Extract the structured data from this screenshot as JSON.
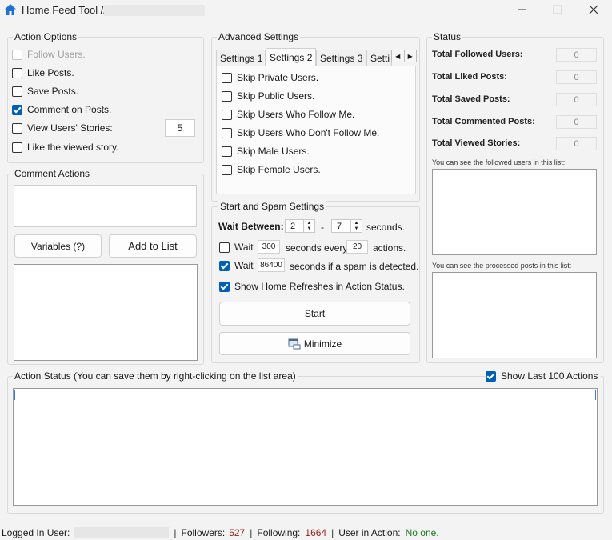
{
  "window": {
    "title": "Home Feed Tool //",
    "minimize_icon": "minimize-icon",
    "maximize_icon": "maximize-icon",
    "close_icon": "close-icon"
  },
  "action_options": {
    "title": "Action Options",
    "items": [
      {
        "label": "Follow Users.",
        "checked": false,
        "disabled": true
      },
      {
        "label": "Like Posts.",
        "checked": false,
        "disabled": false
      },
      {
        "label": "Save Posts.",
        "checked": false,
        "disabled": false
      },
      {
        "label": "Comment on Posts.",
        "checked": true,
        "disabled": false
      },
      {
        "label": "View Users' Stories:",
        "checked": false,
        "disabled": false
      },
      {
        "label": "Like the viewed story.",
        "checked": false,
        "disabled": false
      }
    ],
    "stories_count": "5"
  },
  "comment_actions": {
    "title": "Comment Actions",
    "comment_value": "",
    "variables_label": "Variables (?)",
    "add_label": "Add to List"
  },
  "advanced": {
    "title": "Advanced Settings",
    "tabs": [
      "Settings 1",
      "Settings 2",
      "Settings 3",
      "Setti"
    ],
    "active_tab": "Settings 2",
    "items": [
      {
        "label": "Skip Private Users.",
        "checked": false
      },
      {
        "label": "Skip Public Users.",
        "checked": false
      },
      {
        "label": "Skip Users Who Follow Me.",
        "checked": false
      },
      {
        "label": "Skip Users Who Don't Follow Me.",
        "checked": false
      },
      {
        "label": "Skip Male Users.",
        "checked": false
      },
      {
        "label": "Skip Female Users.",
        "checked": false
      }
    ]
  },
  "start_spam": {
    "title": "Start and Spam Settings",
    "wait_between_label": "Wait Between:",
    "wait_min": "2",
    "dash": "-",
    "wait_max": "7",
    "seconds_label": "seconds.",
    "wait_every": {
      "checked": false,
      "label": "Wait",
      "seconds": "300",
      "mid": "seconds every",
      "actions": "20",
      "end": "actions."
    },
    "wait_spam": {
      "checked": true,
      "label": "Wait",
      "seconds": "86400",
      "end": "seconds if a spam is detected."
    },
    "show_refresh": {
      "checked": true,
      "label": "Show Home Refreshes in Action Status."
    },
    "start_label": "Start",
    "minimize_label": "Minimize"
  },
  "status": {
    "title": "Status",
    "rows": [
      {
        "label": "Total Followed Users:",
        "value": "0"
      },
      {
        "label": "Total Liked Posts:",
        "value": "0"
      },
      {
        "label": "Total Saved Posts:",
        "value": "0"
      },
      {
        "label": "Total Commented Posts:",
        "value": "0"
      },
      {
        "label": "Total Viewed Stories:",
        "value": "0"
      }
    ],
    "followed_hint": "You can see the followed users in this list:",
    "processed_hint": "You can see the processed posts in this list:"
  },
  "action_status": {
    "title": "Action Status (You can save them by right-clicking on the list area)",
    "show_last": {
      "checked": true,
      "label": "Show Last 100 Actions"
    }
  },
  "statusbar": {
    "logged_label": "Logged In User:",
    "followers_label": "Followers:",
    "followers": "527",
    "following_label": "Following:",
    "following": "1664",
    "user_in_action_label": "User in Action:",
    "user_in_action": "No one."
  },
  "colors": {
    "accent": "#005fb8",
    "red": "#9b1c1c",
    "green": "#1e7b1e"
  }
}
